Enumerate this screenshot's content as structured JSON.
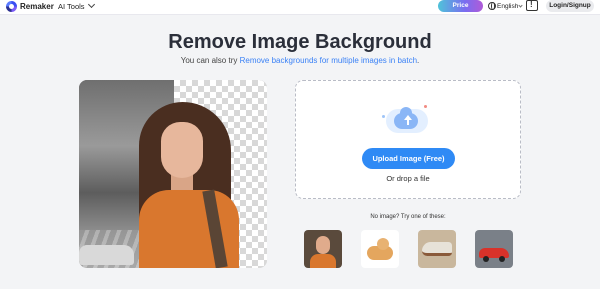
{
  "header": {
    "brand": "Remaker",
    "menu_label": "AI Tools",
    "price_label": "Price",
    "language": "English",
    "login_label": "Login/Signup"
  },
  "main": {
    "title": "Remove Image Background",
    "subtitle_prefix": "You can also try ",
    "subtitle_link": "Remove backgrounds for multiple images in batch",
    "subtitle_suffix": "."
  },
  "upload": {
    "button_label": "Upload Image (Free)",
    "drop_text": "Or drop a file"
  },
  "samples": {
    "label": "No image? Try one of these:",
    "items": [
      {
        "icon": "portrait-thumbnail"
      },
      {
        "icon": "dog-thumbnail"
      },
      {
        "icon": "shoe-thumbnail"
      },
      {
        "icon": "car-thumbnail"
      }
    ]
  },
  "colors": {
    "accent": "#2f8af5",
    "link": "#3b82f6",
    "background": "#f3f4f6"
  }
}
